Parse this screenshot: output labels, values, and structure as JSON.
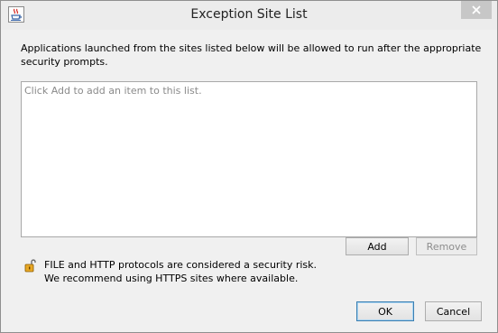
{
  "window": {
    "title": "Exception Site List",
    "app_icon": "java-icon",
    "close_icon": "close-icon"
  },
  "description": "Applications launched from the sites listed below will be allowed to run after the appropriate security prompts.",
  "site_list": {
    "placeholder": "Click Add to add an item to this list.",
    "items": []
  },
  "list_buttons": {
    "add_label": "Add",
    "remove_label": "Remove",
    "remove_enabled": false
  },
  "security_warning": {
    "icon": "unlocked-padlock-icon",
    "line1": "FILE and HTTP protocols are considered a security risk.",
    "line2": "We recommend using HTTPS sites where available."
  },
  "dialog_buttons": {
    "ok_label": "OK",
    "cancel_label": "Cancel"
  },
  "colors": {
    "dialog_background": "#f0f0f0",
    "close_button": "#c7c7c7",
    "default_button_border": "#3c7fb1",
    "lock_body": "#e8a825"
  }
}
